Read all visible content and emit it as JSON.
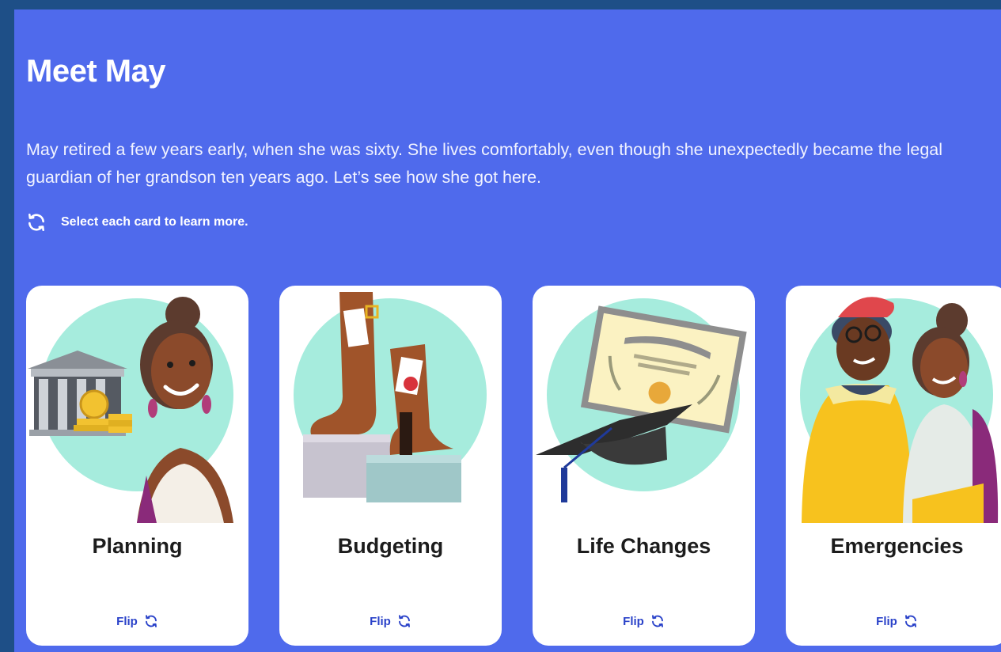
{
  "page": {
    "title": "Meet May",
    "intro": "May retired a few years early, when she was sixty. She lives comfortably, even though she unexpectedly became the legal guardian of her grandson ten years ago. Let’s see how she got here.",
    "instruction": "Select each card to learn more."
  },
  "cards": [
    {
      "label": "Planning",
      "flip_label": "Flip"
    },
    {
      "label": "Budgeting",
      "flip_label": "Flip"
    },
    {
      "label": "Life Changes",
      "flip_label": "Flip"
    },
    {
      "label": "Emergencies",
      "flip_label": "Flip"
    }
  ],
  "colors": {
    "outer_background": "#1e4f87",
    "panel_background": "#4f6aec",
    "card_background": "#ffffff",
    "illustration_circle": "#a6ecdd",
    "flip_text": "#2a42c9"
  },
  "icons": {
    "instruction": "refresh-icon",
    "flip": "refresh-icon"
  }
}
